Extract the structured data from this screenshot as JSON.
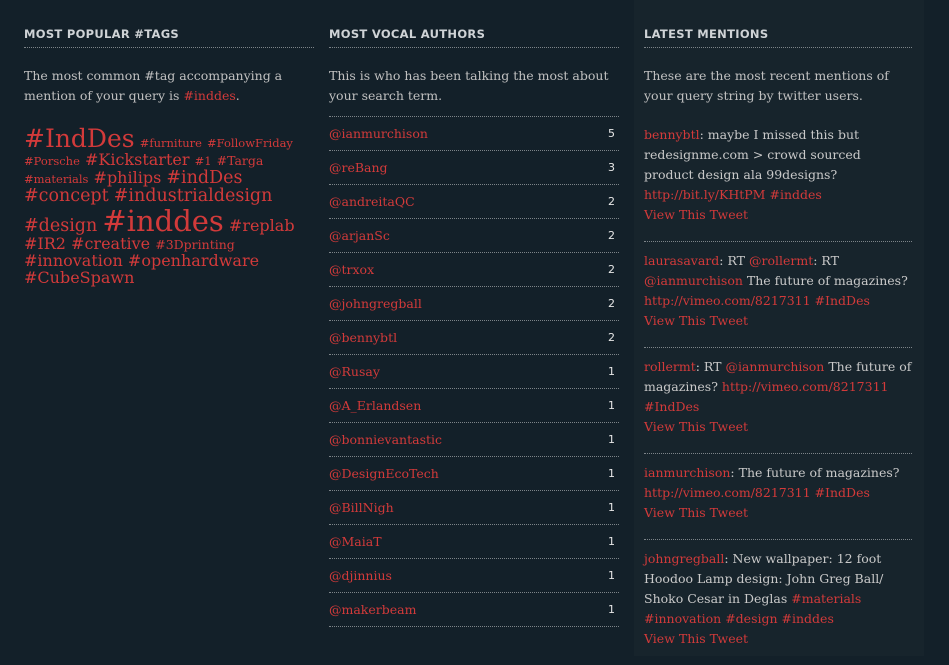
{
  "tags": {
    "title": "MOST POPULAR #TAGS",
    "intro": "The most common #tag accompanying a mention of your query is",
    "query_tag": "#inddes",
    "intro_end": ".",
    "list": [
      {
        "text": "#IndDes",
        "size": 5
      },
      {
        "text": "#furniture",
        "size": 1
      },
      {
        "text": "#FollowFriday",
        "size": 1
      },
      {
        "text": "#Porsche",
        "size": 1
      },
      {
        "text": "#Kickstarter",
        "size": 3
      },
      {
        "text": "#1",
        "size": 1
      },
      {
        "text": "#Targa",
        "size": 2
      },
      {
        "text": "#materials",
        "size": 1
      },
      {
        "text": "#philips",
        "size": 3
      },
      {
        "text": "#indDes",
        "size": 4
      },
      {
        "text": "#concept",
        "size": 4
      },
      {
        "text": "#industrialdesign",
        "size": 4
      },
      {
        "text": "#design",
        "size": 4
      },
      {
        "text": "#inddes",
        "size": 6
      },
      {
        "text": "#replab",
        "size": 3
      },
      {
        "text": "#IR2",
        "size": 3
      },
      {
        "text": "#creative",
        "size": 3
      },
      {
        "text": "#3Dprinting",
        "size": 2
      },
      {
        "text": "#innovation",
        "size": 3
      },
      {
        "text": "#openhardware",
        "size": 3
      },
      {
        "text": "#CubeSpawn",
        "size": 3
      }
    ]
  },
  "authors": {
    "title": "MOST VOCAL AUTHORS",
    "intro": "This is who has been talking the most about your search term.",
    "list": [
      {
        "name": "@ianmurchison",
        "count": "5"
      },
      {
        "name": "@reBang",
        "count": "3"
      },
      {
        "name": "@andreitaQC",
        "count": "2"
      },
      {
        "name": "@arjanSc",
        "count": "2"
      },
      {
        "name": "@trxox",
        "count": "2"
      },
      {
        "name": "@johngregball",
        "count": "2"
      },
      {
        "name": "@bennybtl",
        "count": "2"
      },
      {
        "name": "@Rusay",
        "count": "1"
      },
      {
        "name": "@A_Erlandsen",
        "count": "1"
      },
      {
        "name": "@bonnievantastic",
        "count": "1"
      },
      {
        "name": "@DesignEcoTech",
        "count": "1"
      },
      {
        "name": "@BillNigh",
        "count": "1"
      },
      {
        "name": "@MaiaT",
        "count": "1"
      },
      {
        "name": "@djinnius",
        "count": "1"
      },
      {
        "name": "@makerbeam",
        "count": "1"
      }
    ]
  },
  "mentions": {
    "title": "LATEST MENTIONS",
    "intro": "These are the most recent mentions of your query string by twitter users.",
    "view_label": "View This Tweet",
    "list": [
      {
        "parts": [
          {
            "t": "bennybtl",
            "link": true
          },
          {
            "t": ": maybe I missed this but redesignme.com > crowd sourced product design ala 99designs? "
          },
          {
            "t": "http://bit.ly/KHtPM",
            "link": true
          },
          {
            "t": " "
          },
          {
            "t": "#inddes",
            "link": true
          }
        ]
      },
      {
        "parts": [
          {
            "t": "laurasavard",
            "link": true
          },
          {
            "t": ": RT "
          },
          {
            "t": "@rollermt",
            "link": true
          },
          {
            "t": ": RT "
          },
          {
            "t": "@ianmurchison",
            "link": true
          },
          {
            "t": " The future of magazines? "
          },
          {
            "t": "http://vimeo.com/8217311",
            "link": true
          },
          {
            "t": " "
          },
          {
            "t": "#IndDes",
            "link": true
          }
        ]
      },
      {
        "parts": [
          {
            "t": "rollermt",
            "link": true
          },
          {
            "t": ": RT "
          },
          {
            "t": "@ianmurchison",
            "link": true
          },
          {
            "t": " The future of magazines? "
          },
          {
            "t": "http://vimeo.com/8217311",
            "link": true
          },
          {
            "t": " "
          },
          {
            "t": "#IndDes",
            "link": true
          }
        ]
      },
      {
        "parts": [
          {
            "t": "ianmurchison",
            "link": true
          },
          {
            "t": ": The future of magazines? "
          },
          {
            "t": "http://vimeo.com/8217311",
            "link": true
          },
          {
            "t": " "
          },
          {
            "t": "#IndDes",
            "link": true
          }
        ]
      },
      {
        "parts": [
          {
            "t": "johngregball",
            "link": true
          },
          {
            "t": ": New wallpaper: 12 foot Hoodoo Lamp design: John Greg Ball/ Shoko Cesar in Deglas "
          },
          {
            "t": "#materials",
            "link": true
          },
          {
            "t": " "
          },
          {
            "t": "#innovation",
            "link": true
          },
          {
            "t": " "
          },
          {
            "t": "#design",
            "link": true
          },
          {
            "t": " "
          },
          {
            "t": "#inddes",
            "link": true
          }
        ]
      }
    ]
  }
}
